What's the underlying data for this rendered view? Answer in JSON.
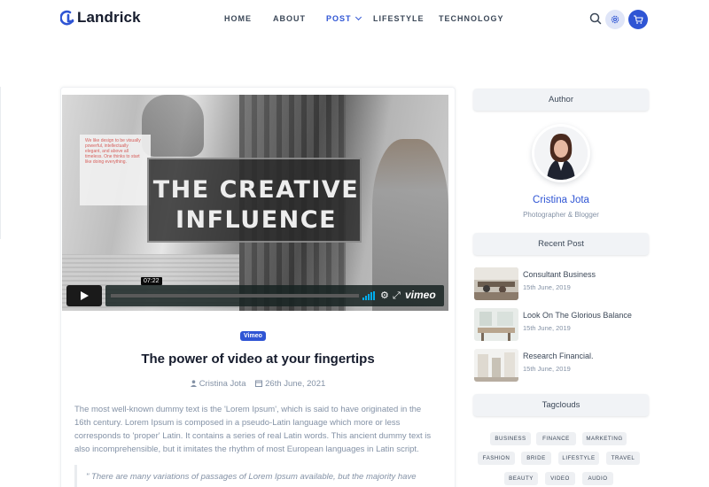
{
  "brand": {
    "name": "Landrick",
    "accent": "#2f55d4"
  },
  "nav": {
    "items": [
      {
        "label": "HOME",
        "active": false
      },
      {
        "label": "ABOUT",
        "active": false
      },
      {
        "label": "POST",
        "active": true,
        "dropdown": true
      },
      {
        "label": "LIFESTYLE",
        "active": false
      },
      {
        "label": "TECHNOLOGY",
        "active": false
      }
    ],
    "icons": [
      "search-icon",
      "settings-icon",
      "cart-icon"
    ]
  },
  "video": {
    "title_line1": "THE CREATIVE",
    "title_line2": "INFLUENCE",
    "timestamp": "07:22",
    "provider": "vimeo",
    "side_text": "We like design to be visually powerful, intellectually elegant, and above all timeless. One thinks to start like doing everything."
  },
  "post": {
    "tag": "Vimeo",
    "title": "The power of video at your fingertips",
    "author": "Cristina Jota",
    "date": "26th June, 2021",
    "body": "The most well-known dummy text is the 'Lorem Ipsum', which is said to have originated in the 16th century. Lorem Ipsum is composed in a pseudo-Latin language which more or less corresponds to 'proper' Latin. It contains a series of real Latin words. This ancient dummy text is also incomprehensible, but it imitates the rhythm of most European languages in Latin script.",
    "quote": "\" There are many variations of passages of Lorem Ipsum available, but the majority have"
  },
  "sidebar": {
    "author_heading": "Author",
    "author_name": "Cristina Jota",
    "author_role": "Photographer & Blogger",
    "recent_heading": "Recent Post",
    "recent": [
      {
        "title": "Consultant Business",
        "date": "15th June, 2019"
      },
      {
        "title": "Look On The Glorious Balance",
        "date": "15th June, 2019"
      },
      {
        "title": "Research Financial.",
        "date": "15th June, 2019"
      }
    ],
    "tags_heading": "Tagclouds",
    "tags": [
      "BUSINESS",
      "FINANCE",
      "MARKETING",
      "FASHION",
      "BRIDE",
      "LIFESTYLE",
      "TRAVEL",
      "BEAUTY",
      "VIDEO",
      "AUDIO"
    ]
  }
}
